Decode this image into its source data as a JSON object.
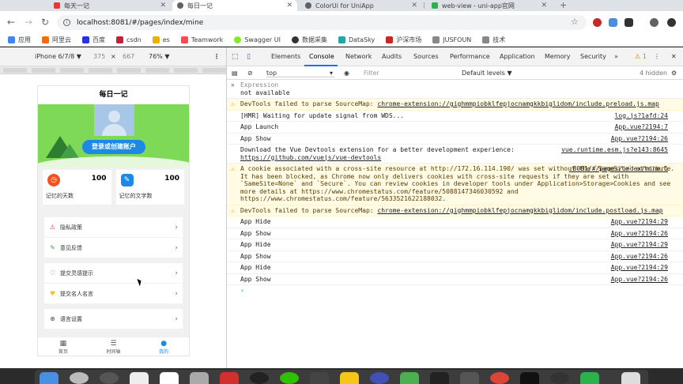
{
  "browser": {
    "tabs": [
      {
        "title": "每天一记",
        "color": "#e53935"
      },
      {
        "title": "每日一记",
        "color": "#5f6368",
        "active": true
      },
      {
        "title": "ColorUi for UniApp",
        "color": "#5f6368"
      },
      {
        "title": "web-view - uni-app官网",
        "color": "#2bb24c"
      }
    ],
    "url": "localhost:8081/#/pages/index/mine",
    "bookmarks": [
      {
        "label": "应用",
        "color": "#4285f4"
      },
      {
        "label": "阿里云",
        "color": "#ff6a00"
      },
      {
        "label": "百度",
        "color": "#2932e1"
      },
      {
        "label": "csdn",
        "color": "#c32136"
      },
      {
        "label": "es",
        "color": "#f0b000"
      },
      {
        "label": "Teamwork",
        "color": "#ff4b4b"
      },
      {
        "label": "Swagger UI",
        "color": "#85ea2d"
      },
      {
        "label": "数据采集",
        "color": "#333333"
      },
      {
        "label": "DataSky",
        "color": "#23a6a6"
      },
      {
        "label": "沪深市场",
        "color": "#c62828"
      },
      {
        "label": "JUSFOUN",
        "color": "#888888"
      },
      {
        "label": "技术",
        "color": "#888888"
      }
    ]
  },
  "device": {
    "model": "iPhone 6/7/8 ▼",
    "width": "375",
    "times": "×",
    "height": "667",
    "zoom": "76% ▼"
  },
  "app": {
    "title": "每日一记",
    "login_button": "登录或创建账户",
    "stats": [
      {
        "label": "记忆的天数",
        "value": "100",
        "color": "#f4511e",
        "icon": "clock-icon"
      },
      {
        "label": "记忆的文字数",
        "value": "100",
        "color": "#1e88e5",
        "icon": "edit-icon"
      }
    ],
    "menu1": [
      {
        "label": "隐私政策",
        "icon": "warning-icon",
        "color": "#e53935"
      },
      {
        "label": "意见反馈",
        "icon": "pencil-icon",
        "color": "#43a047"
      }
    ],
    "menu2": [
      {
        "label": "提交灵感提示",
        "icon": "bulb-icon",
        "color": "#7e57c2"
      },
      {
        "label": "提交名人名言",
        "icon": "badge-icon",
        "color": "#fbc02d"
      }
    ],
    "menu3": [
      {
        "label": "语言设置",
        "icon": "globe-icon",
        "color": "#555555"
      }
    ],
    "tabbar": [
      {
        "label": "首页",
        "icon": "calendar-icon"
      },
      {
        "label": "时间轴",
        "icon": "timeline-icon"
      },
      {
        "label": "我的",
        "icon": "user-icon",
        "active": true
      }
    ]
  },
  "devtools": {
    "tabs": [
      "Elements",
      "Console",
      "Network",
      "Audits",
      "Sources",
      "Performance",
      "Application",
      "Memory",
      "Security"
    ],
    "active_tab": "Console",
    "more": "»",
    "warnings": "⚠ 1",
    "context": "top",
    "filter_placeholder": "Filter",
    "levels": "Default levels ▼",
    "hidden": "4 hidden",
    "expression_label": "Expression",
    "expression_value": "not available",
    "logs": [
      {
        "type": "warn",
        "text": "DevTools failed to parse SourceMap: ",
        "link": "chrome-extension://gighmmpiobklfepjocnamgkkbiglidom/include.preload.js.map",
        "src": ""
      },
      {
        "type": "log",
        "text": "[HMR] Waiting for update signal from WDS...",
        "link": "",
        "src": "log.js?1afd:24"
      },
      {
        "type": "log",
        "text": "App Launch",
        "link": "",
        "src": "App.vue?2194:7"
      },
      {
        "type": "log",
        "text": "App Show",
        "link": "",
        "src": "App.vue?2194:26"
      },
      {
        "type": "log",
        "text": "Download the Vue Devtools extension for a better development experience:",
        "link": "https://github.com/vuejs/vue-devtools",
        "src": "vue.runtime.esm.js?e143:8645"
      },
      {
        "type": "warn",
        "text": "A cookie associated with a cross-site resource at http://172.16.114.190/ was set without the `SameSite` attribute. It has been blocked, as Chrome now only delivers cookies with cross-site requests if they are set with `SameSite=None` and `Secure`. You can review cookies in developer tools under Application>Storage>Cookies and see more details at https://www.chromestatus.com/feature/5088147346030592 and https://www.chromestatus.com/feature/5633521622188032.",
        "link": "",
        "src": ":8081/#/pages/index/mine:1"
      },
      {
        "type": "warn",
        "text": "DevTools failed to parse SourceMap: ",
        "link": "chrome-extension://gighmmpiobklfepjocnamgkkbiglidom/include.postload.js.map",
        "src": ""
      },
      {
        "type": "log",
        "text": "App Hide",
        "link": "",
        "src": "App.vue?2194:29"
      },
      {
        "type": "log",
        "text": "App Show",
        "link": "",
        "src": "App.vue?2194:26"
      },
      {
        "type": "log",
        "text": "App Hide",
        "link": "",
        "src": "App.vue?2194:29"
      },
      {
        "type": "log",
        "text": "App Show",
        "link": "",
        "src": "App.vue?2194:26"
      },
      {
        "type": "log",
        "text": "App Hide",
        "link": "",
        "src": "App.vue?2194:29"
      },
      {
        "type": "log",
        "text": "App Show",
        "link": "",
        "src": "App.vue?2194:26"
      }
    ],
    "prompt": "›"
  }
}
